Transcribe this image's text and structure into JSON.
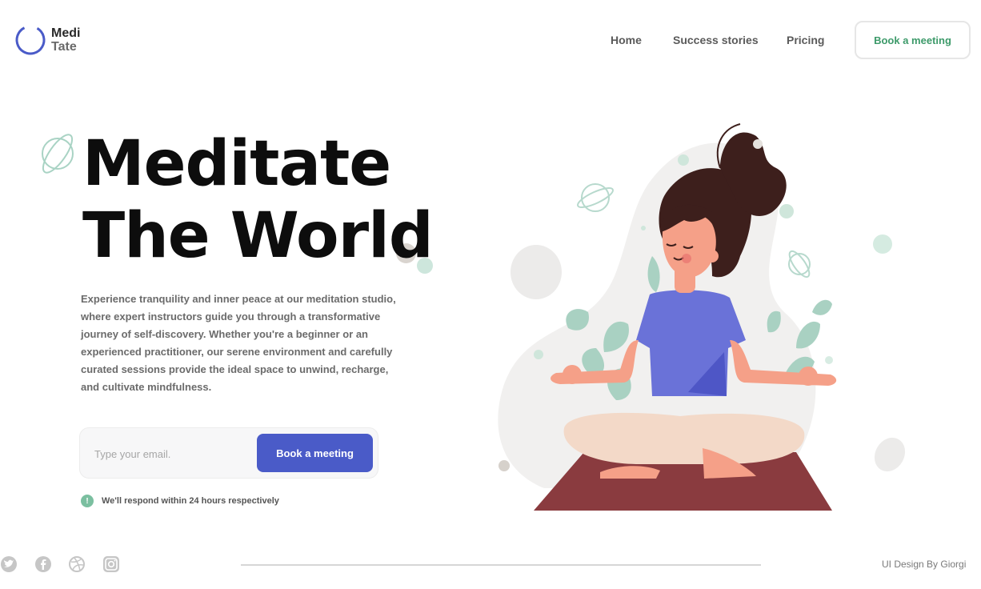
{
  "brand": {
    "line1": "Medi",
    "line2": "Tate"
  },
  "nav": {
    "items": [
      "Home",
      "Success stories",
      "Pricing"
    ],
    "cta_label": "Book a meeting"
  },
  "hero": {
    "title_line1": "Meditate",
    "title_line2": "The World",
    "description": "Experience tranquility and inner peace at our meditation studio, where expert instructors guide you through a transformative journey of self-discovery. Whether you're a beginner or an experienced practitioner, our serene environment and carefully curated sessions provide the ideal space to unwind, recharge, and cultivate mindfulness."
  },
  "signup": {
    "email_placeholder": "Type your email.",
    "button_label": "Book a meeting",
    "note_icon": "!",
    "note": "We'll respond within 24 hours respectively"
  },
  "footer": {
    "social_icons": [
      "twitter-icon",
      "facebook-icon",
      "dribbble-icon",
      "instagram-icon"
    ],
    "credit": "UI Design By Giorgi"
  },
  "colors": {
    "accent": "#4a5bc8",
    "green": "#3d9a6a",
    "mat": "#8a3b3f",
    "hair": "#3d1f1c",
    "shirt": "#6a72d8",
    "skin": "#f5a088"
  }
}
